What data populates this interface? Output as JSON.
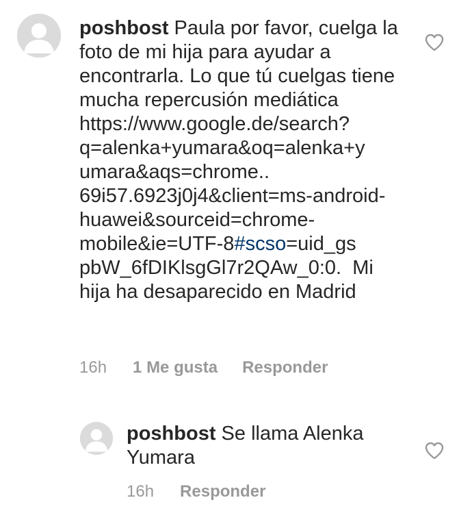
{
  "comments": [
    {
      "username": "poshbost",
      "text_before": " Paula por favor, cuelga la foto de mi hija para ayudar a encontrarla. Lo que tú cuelgas tiene mucha repercusión mediática https://​www.google.de/search?​q=alenka+yumara&oq=alenka+y​umara&aqs=chrome..​69i57.6923j0j4&client=ms-​android-​huawei&sourceid=chrome-​mobile&ie=UTF-8",
      "hashtag": "#scso",
      "text_after": "=uid_gs​pbW_6fDIKlsgGl7r2QAw_0:0.  Mi hija ha desaparecido en Madrid",
      "time": "16h",
      "likes": "1 Me gusta",
      "reply_label": "Responder",
      "like_icon": "heart-outline-icon"
    },
    {
      "username": "poshbost",
      "text": " Se llama Alenka Yumara",
      "time": "16h",
      "reply_label": "Responder",
      "like_icon": "heart-outline-icon"
    }
  ],
  "colors": {
    "text": "#262626",
    "meta": "#999999",
    "hashtag": "#003569",
    "avatar_bg": "#dbdbdb"
  }
}
